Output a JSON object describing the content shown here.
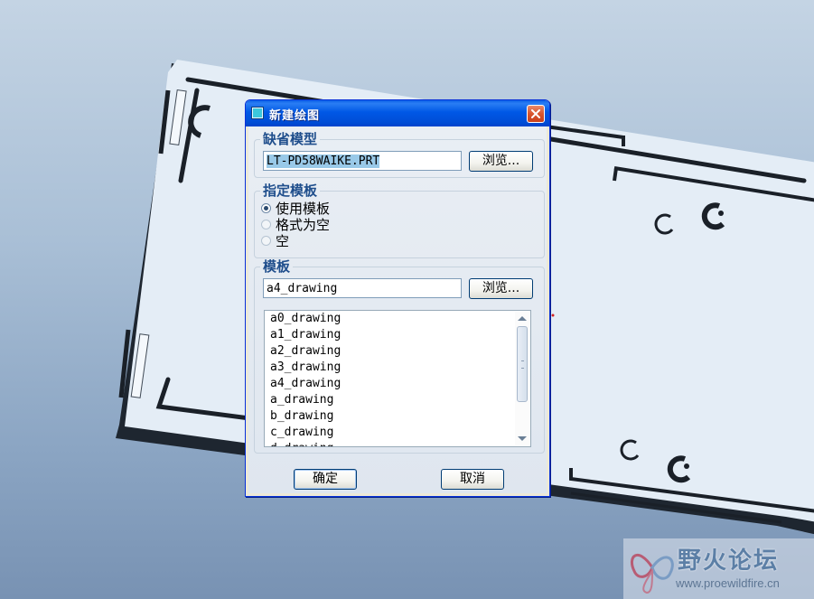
{
  "window": {
    "title": "新建绘图",
    "close_glyph": "×"
  },
  "default_model": {
    "legend": "缺省模型",
    "value": "LT-PD58WAIKE.PRT",
    "browse_label": "浏览..."
  },
  "template_spec": {
    "legend": "指定模板",
    "options": [
      {
        "label": "使用模板",
        "checked": true
      },
      {
        "label": "格式为空",
        "checked": false
      },
      {
        "label": "空",
        "checked": false
      }
    ]
  },
  "template": {
    "legend": "模板",
    "value": "a4_drawing",
    "browse_label": "浏览...",
    "items": [
      "a0_drawing",
      "a1_drawing",
      "a2_drawing",
      "a3_drawing",
      "a4_drawing",
      "a_drawing",
      "b_drawing",
      "c_drawing",
      "d_drawing"
    ]
  },
  "buttons": {
    "ok_label": "确定",
    "cancel_label": "取消"
  },
  "watermark": {
    "title": "野火论坛",
    "url": "www.proewildfire.cn"
  },
  "colors": {
    "titlebar": "#0058e6",
    "legend_text": "#1f4e8c",
    "close_button": "#d8552e",
    "viewport_top": "#c4d4e4",
    "viewport_bottom": "#7892b3"
  }
}
